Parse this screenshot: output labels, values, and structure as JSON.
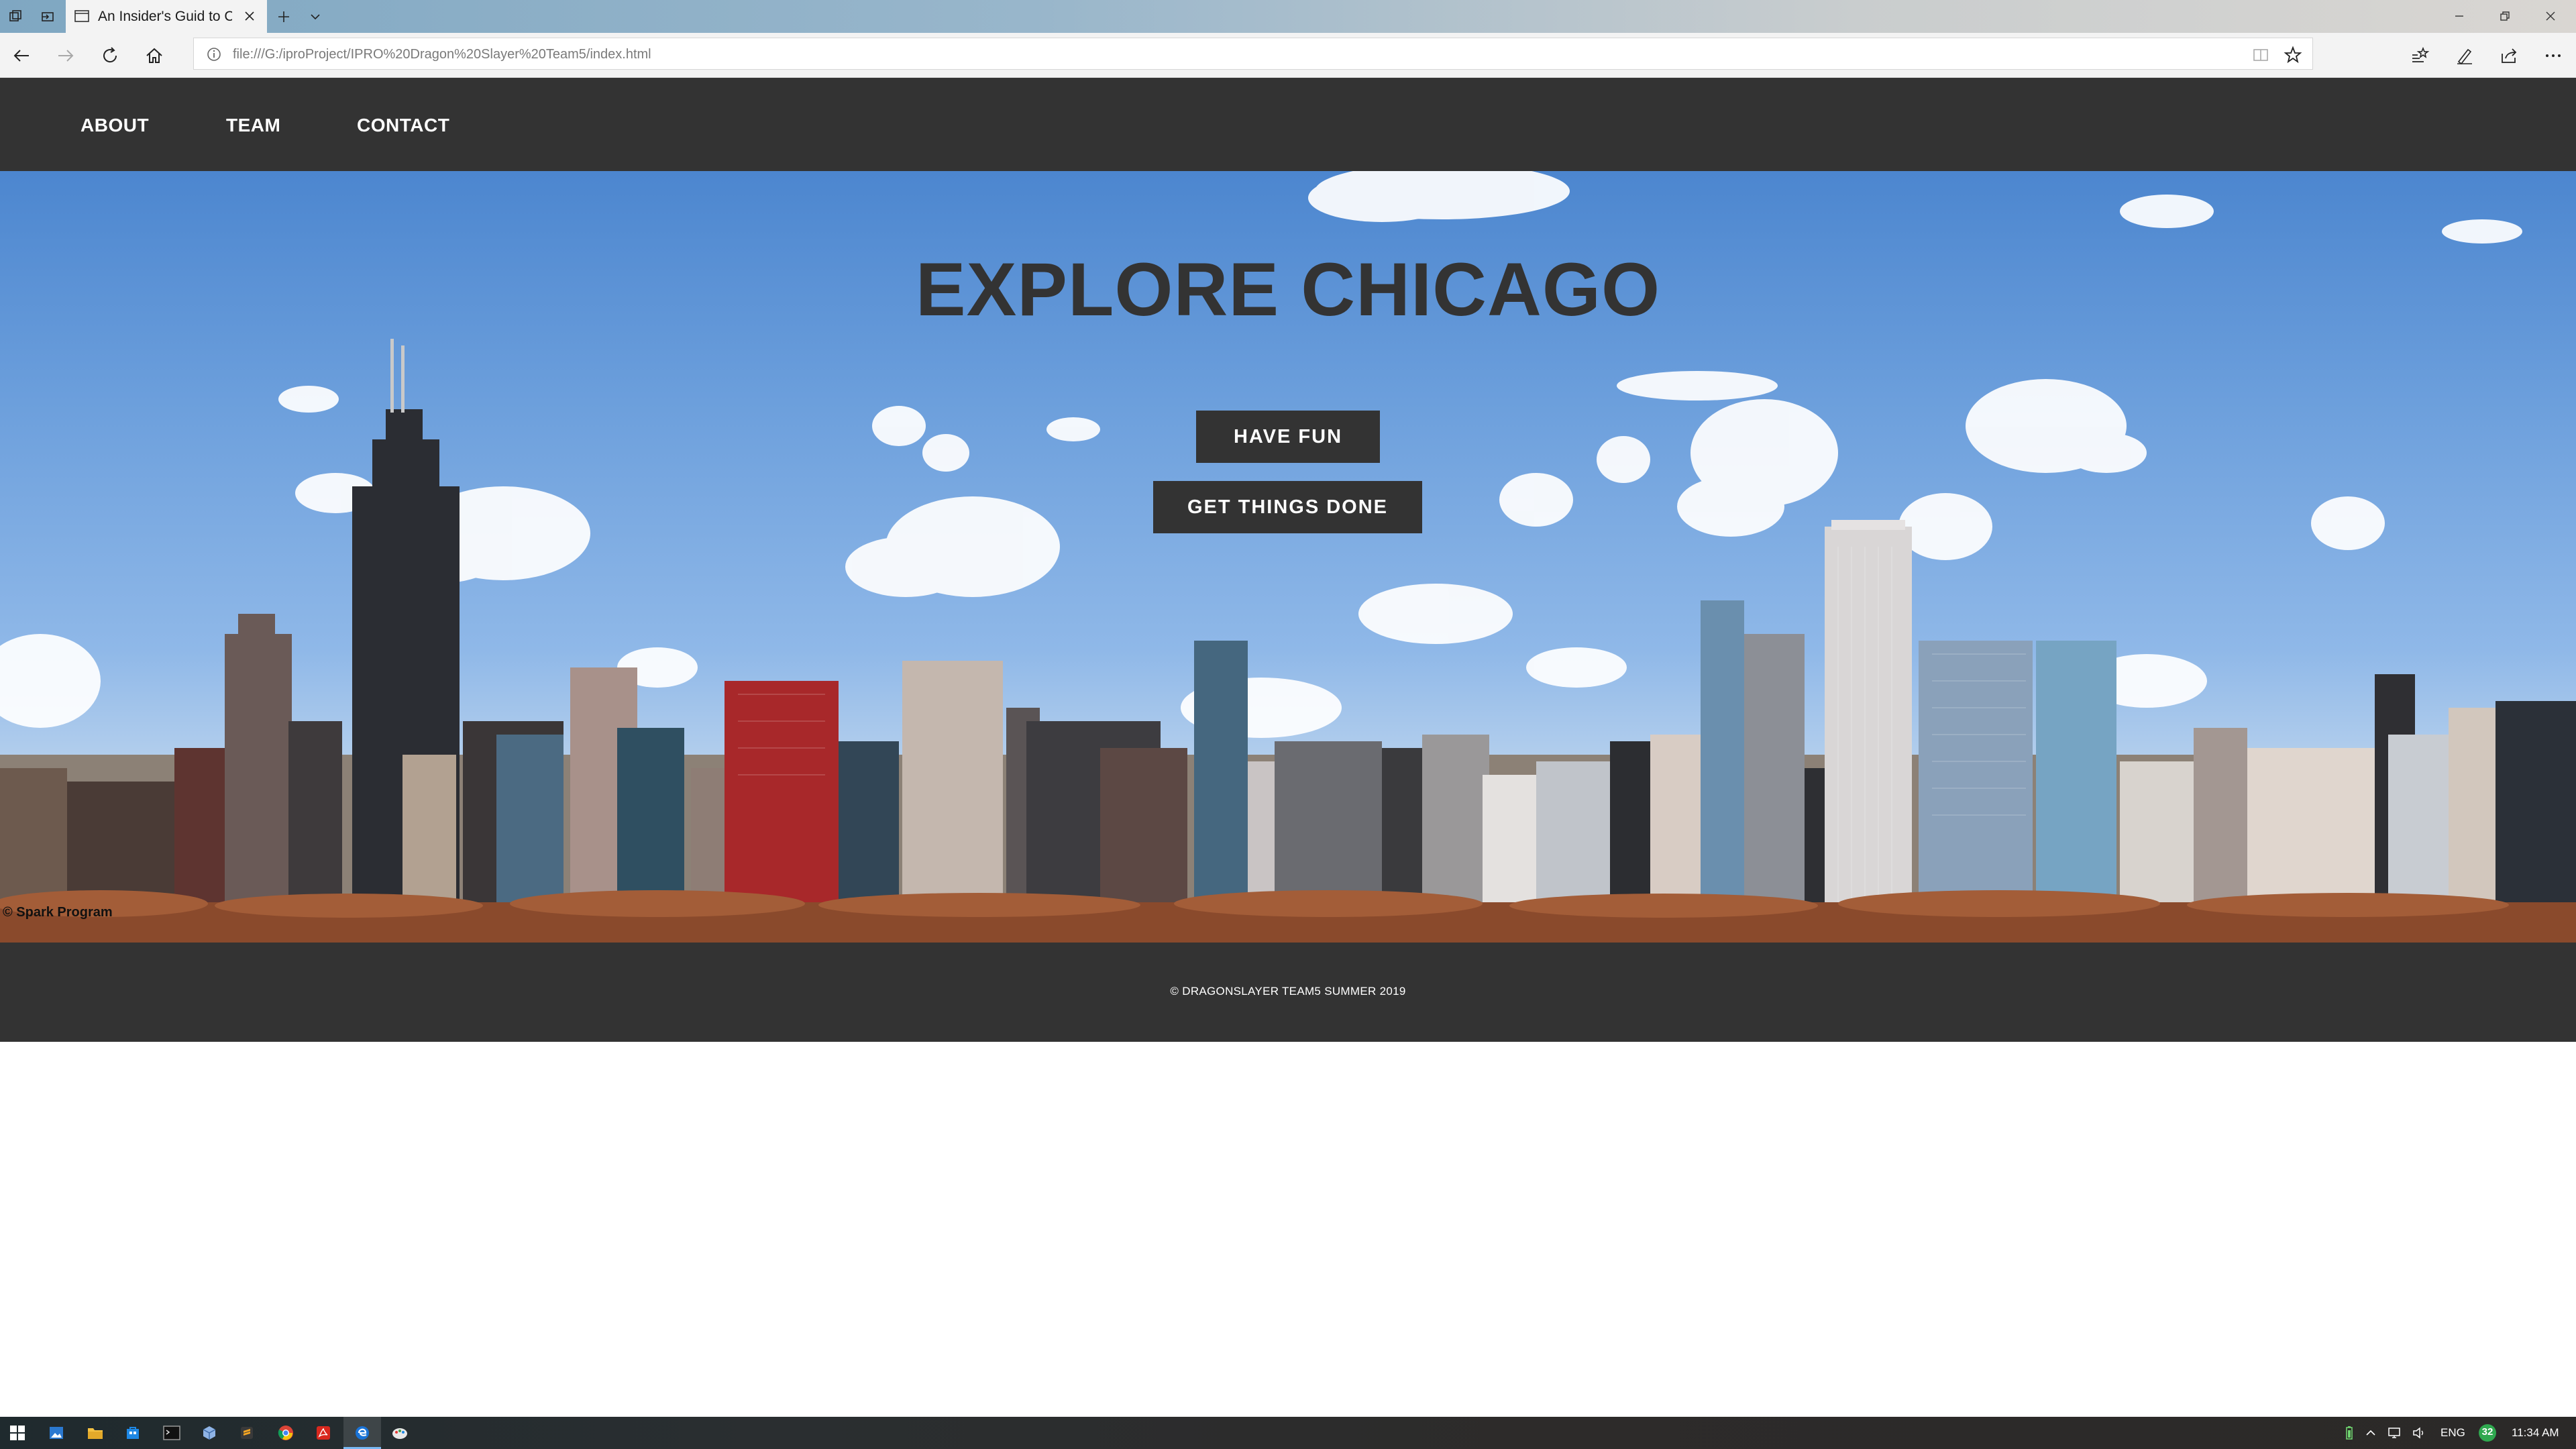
{
  "browser": {
    "tab_title": "An Insider's Guid to Chi",
    "url": "file:///G:/iproProject/IPRO%20Dragon%20Slayer%20Team5/index.html"
  },
  "site": {
    "nav": [
      "ABOUT",
      "TEAM",
      "CONTACT"
    ],
    "hero_title": "EXPLORE CHICAGO",
    "buttons": [
      "HAVE FUN",
      "GET THINGS DONE"
    ],
    "photo_credit": "© Spark Program",
    "footer": "© DRAGONSLAYER TEAM5 SUMMER 2019"
  },
  "taskbar": {
    "language": "ENG",
    "notification_count": "32",
    "time": "11:34 AM"
  },
  "colors": {
    "header_bg": "#333333",
    "button_bg": "#333333",
    "text_light": "#ffffff"
  }
}
